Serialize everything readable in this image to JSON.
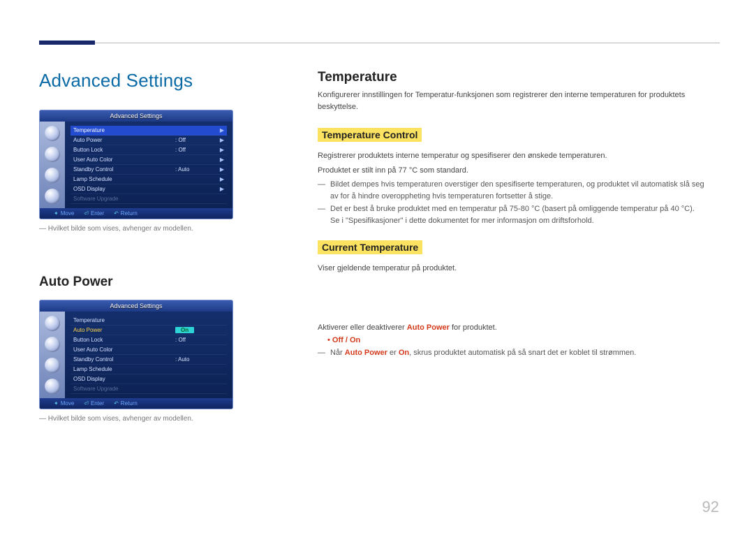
{
  "page_number": "92",
  "left": {
    "title": "Advanced Settings",
    "caption": "Hvilket bilde som vises, avhenger av modellen.",
    "osd1": {
      "title": "Advanced Settings",
      "rows": [
        {
          "label": "Temperature",
          "value": "",
          "arrow": "▶",
          "style": "highlight"
        },
        {
          "label": "Auto Power",
          "value": ": Off",
          "arrow": "▶",
          "style": ""
        },
        {
          "label": "Button Lock",
          "value": ": Off",
          "arrow": "▶",
          "style": ""
        },
        {
          "label": "User Auto Color",
          "value": "",
          "arrow": "▶",
          "style": ""
        },
        {
          "label": "Standby Control",
          "value": ": Auto",
          "arrow": "▶",
          "style": ""
        },
        {
          "label": "Lamp Schedule",
          "value": "",
          "arrow": "▶",
          "style": ""
        },
        {
          "label": "OSD Display",
          "value": "",
          "arrow": "▶",
          "style": ""
        },
        {
          "label": "Software Upgrade",
          "value": "",
          "arrow": "",
          "style": "dim"
        }
      ],
      "footer": {
        "move": "Move",
        "enter": "Enter",
        "return": "Return"
      }
    },
    "heading2": "Auto Power",
    "osd2": {
      "title": "Advanced Settings",
      "rows": [
        {
          "label": "Temperature",
          "value": "",
          "arrow": "",
          "style": ""
        },
        {
          "label": "Auto Power",
          "value": "On",
          "arrow": "",
          "style": "highlight-yellow",
          "box": true
        },
        {
          "label": "Button Lock",
          "value": ": Off",
          "arrow": "",
          "style": ""
        },
        {
          "label": "User Auto Color",
          "value": "",
          "arrow": "",
          "style": ""
        },
        {
          "label": "Standby Control",
          "value": ": Auto",
          "arrow": "",
          "style": ""
        },
        {
          "label": "Lamp Schedule",
          "value": "",
          "arrow": "",
          "style": ""
        },
        {
          "label": "OSD Display",
          "value": "",
          "arrow": "",
          "style": ""
        },
        {
          "label": "Software Upgrade",
          "value": "",
          "arrow": "",
          "style": "dim"
        }
      ],
      "footer": {
        "move": "Move",
        "enter": "Enter",
        "return": "Return"
      }
    }
  },
  "right": {
    "h_temperature": "Temperature",
    "p_temperature_intro": "Konfigurerer innstillingen for Temperatur-funksjonen som registrerer den interne temperaturen for produktets beskyttelse.",
    "h_temp_control": "Temperature Control",
    "p_tc_1": "Registrerer produktets interne temperatur og spesifiserer den ønskede temperaturen.",
    "p_tc_2": "Produktet er stilt inn på 77 °C som standard.",
    "dash_tc_1": "Bildet dempes hvis temperaturen overstiger den spesifiserte temperaturen, og produktet vil automatisk slå seg av for å hindre overoppheting hvis temperaturen fortsetter å stige.",
    "dash_tc_2a": "Det er best å bruke produktet med en temperatur på 75-80 °C (basert på omliggende temperatur på 40 °C).",
    "dash_tc_2b": "Se i \"Spesifikasjoner\" i dette dokumentet for mer informasjon om driftsforhold.",
    "h_curr_temp": "Current Temperature",
    "p_curr_temp": "Viser gjeldende temperatur på produktet.",
    "p_ap_1a": "Aktiverer eller deaktiverer ",
    "p_ap_1_accent": "Auto Power",
    "p_ap_1b": " for produktet.",
    "bullet_offon": "Off / On",
    "dash_ap_pre": "Når ",
    "dash_ap_mid": " er ",
    "dash_ap_on": "On",
    "dash_ap_post": ", skrus produktet automatisk på så snart det er koblet til strømmen."
  }
}
